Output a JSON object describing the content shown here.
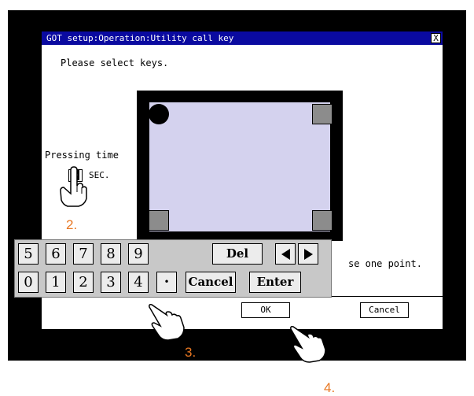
{
  "dialog": {
    "title": "GOT setup:Operation:Utility call key",
    "close_label": "X",
    "instruction": "Please select keys.",
    "pressing_time_label": "Pressing time",
    "pressing_time_value": "0",
    "sec_label": "SEC.",
    "point_hint": "se one point.",
    "ok_label": "OK",
    "cancel_label": "Cancel"
  },
  "keypad": {
    "row1": [
      "5",
      "6",
      "7",
      "8",
      "9"
    ],
    "row2": [
      "0",
      "1",
      "2",
      "3",
      "4"
    ],
    "del_label": "Del",
    "dot_label": "•",
    "cancel_label": "Cancel",
    "enter_label": "Enter",
    "left_arrow_icon": "left-arrow-icon",
    "right_arrow_icon": "right-arrow-icon"
  },
  "steps": {
    "step2": "2.",
    "step3": "3.",
    "step4": "4."
  },
  "colors": {
    "title_bar": "#0a0aa0",
    "touch_area": "#d4d2ee",
    "step_number": "#e87722"
  }
}
